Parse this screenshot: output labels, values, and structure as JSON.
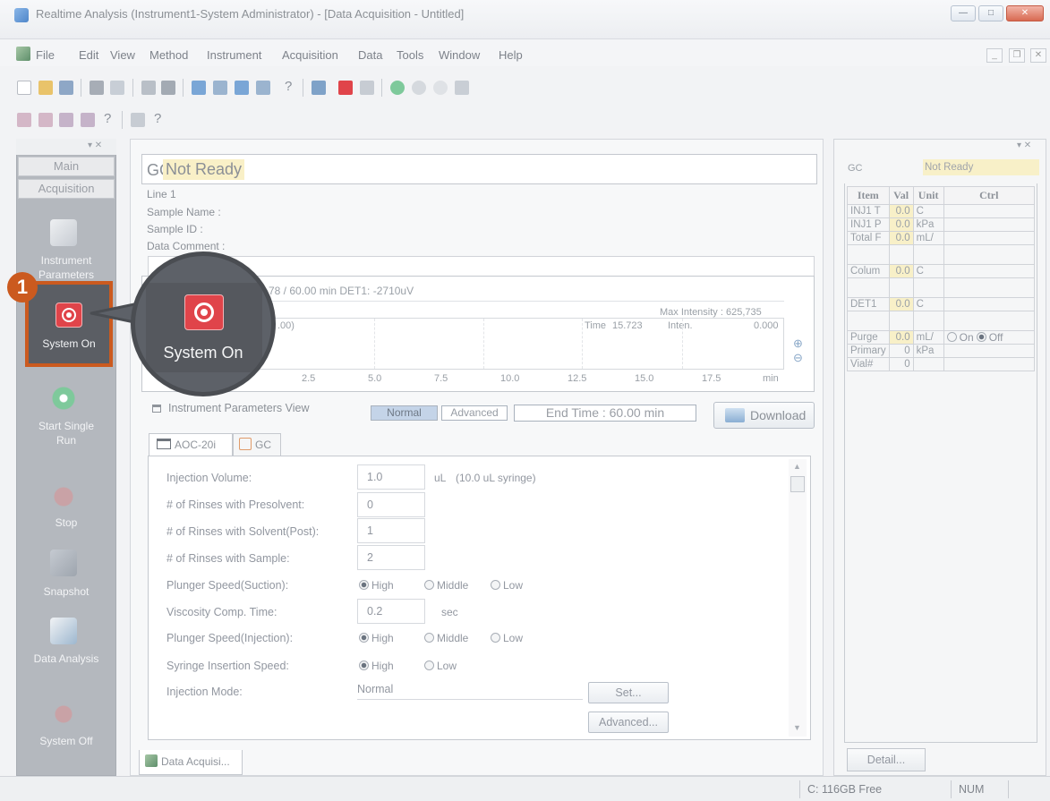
{
  "window": {
    "title": "Realtime Analysis (Instrument1-System Administrator) - [Data Acquisition - Untitled]"
  },
  "menu": [
    "File",
    "Edit",
    "View",
    "Method",
    "Instrument",
    "Acquisition",
    "Data",
    "Tools",
    "Window",
    "Help"
  ],
  "toolbar": {
    "help_q": "?"
  },
  "sidebar": {
    "tabs": [
      "Main",
      "Acquisition"
    ],
    "items": [
      {
        "label": "Instrument Parameters",
        "icon": "instrument-parameters-icon"
      },
      {
        "label": "System On",
        "icon": "record-icon"
      },
      {
        "label": "Start Single Run",
        "icon": "start-icon"
      },
      {
        "label": "Stop",
        "icon": "stop-icon"
      },
      {
        "label": "Snapshot",
        "icon": "snapshot-icon"
      },
      {
        "label": "Data Analysis",
        "icon": "data-analysis-icon"
      },
      {
        "label": "System Off",
        "icon": "power-icon"
      }
    ]
  },
  "status_header": {
    "prefix": "GC",
    "status": "Not Ready"
  },
  "info": {
    "line": "Line 1",
    "sample_name": "Sample Name :",
    "sample_id": "Sample ID :",
    "data_comment": "Data Comment :"
  },
  "chart": {
    "header": "78 / 60.00 min DET1: -2710uV",
    "max_intensity": "Max Intensity : 625,735",
    "left_value": ".00)",
    "time_label": "Time",
    "time_value": "15.723",
    "inten_label": "Inten.",
    "inten_value": "0.000",
    "ticks": [
      "2.5",
      "5.0",
      "7.5",
      "10.0",
      "12.5",
      "15.0",
      "17.5"
    ],
    "unit": "min"
  },
  "ipv": {
    "title": "Instrument Parameters View",
    "normal": "Normal",
    "advanced": "Advanced",
    "end_time": "End Time : 60.00 min",
    "download": "Download",
    "tabs": [
      "AOC-20i",
      "GC"
    ]
  },
  "form": {
    "injection_volume": {
      "label": "Injection Volume:",
      "value": "1.0",
      "unit": "uL",
      "note": "(10.0 uL syringe)"
    },
    "rinses_pre": {
      "label": "# of Rinses with Presolvent:",
      "value": "0"
    },
    "rinses_post": {
      "label": "# of Rinses with Solvent(Post):",
      "value": "1"
    },
    "rinses_sample": {
      "label": "# of Rinses with Sample:",
      "value": "2"
    },
    "plunger_suction": {
      "label": "Plunger Speed(Suction):",
      "options": [
        "High",
        "Middle",
        "Low"
      ],
      "selected": "High"
    },
    "viscosity": {
      "label": "Viscosity Comp. Time:",
      "value": "0.2",
      "unit": "sec"
    },
    "plunger_injection": {
      "label": "Plunger Speed(Injection):",
      "options": [
        "High",
        "Middle",
        "Low"
      ],
      "selected": "High"
    },
    "syringe_speed": {
      "label": "Syringe Insertion Speed:",
      "options": [
        "High",
        "Low"
      ],
      "selected": "High"
    },
    "injection_mode": {
      "label": "Injection Mode:",
      "value": "Normal"
    },
    "set_button": "Set...",
    "advanced_button": "Advanced..."
  },
  "bottom_tab": "Data Acquisi...",
  "right_panel": {
    "label": "GC",
    "status": "Not Ready",
    "headers": [
      "Item",
      "Val",
      "Unit",
      "Ctrl"
    ],
    "rows": [
      {
        "item": "INJ1 T",
        "val": "0.0",
        "unit": "C"
      },
      {
        "item": "INJ1 P",
        "val": "0.0",
        "unit": "kPa"
      },
      {
        "item": "Total F",
        "val": "0.0",
        "unit": "mL/"
      },
      {
        "item": "",
        "val": "",
        "unit": ""
      },
      {
        "item": "Colum",
        "val": "0.0",
        "unit": "C"
      },
      {
        "item": "",
        "val": "",
        "unit": ""
      },
      {
        "item": "DET1",
        "val": "0.0",
        "unit": "C"
      },
      {
        "item": "",
        "val": "",
        "unit": ""
      },
      {
        "item": "Purge",
        "val": "0.0",
        "unit": "mL/"
      },
      {
        "item": "Primary",
        "val": "0",
        "unit": "kPa"
      },
      {
        "item": "Vial#",
        "val": "0",
        "unit": ""
      }
    ],
    "purge_options": [
      "On",
      "Off"
    ],
    "purge_selected": "Off",
    "detail_button": "Detail..."
  },
  "status_bar": {
    "disk": "C: 116GB Free",
    "num": "NUM"
  },
  "callout": {
    "number": "1",
    "label": "System On"
  },
  "colors": {
    "accent": "#cb5a1f",
    "record": "#e0444a",
    "not_ready": "#f9f0c7"
  }
}
